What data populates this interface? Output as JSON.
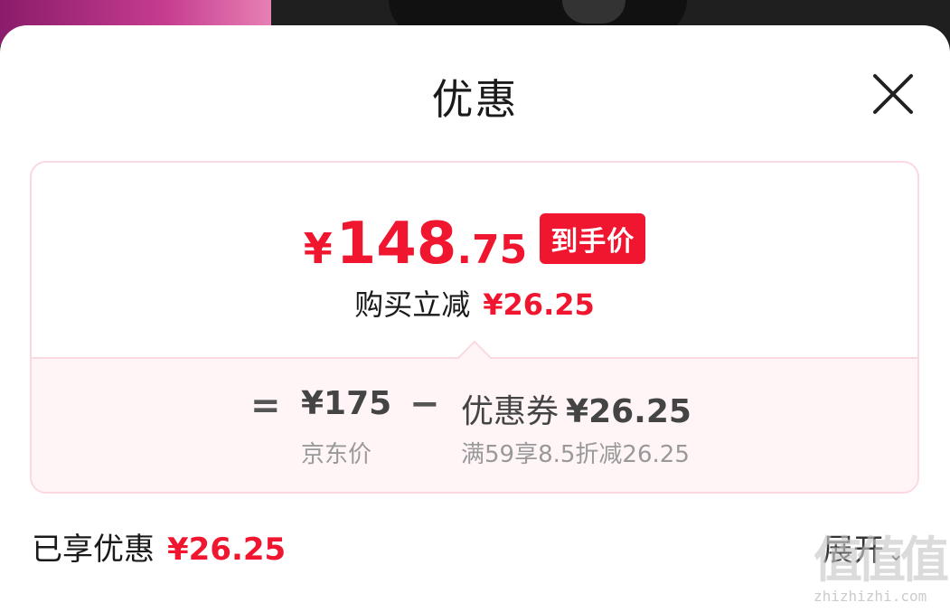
{
  "sheet": {
    "title": "优惠"
  },
  "price_card": {
    "final_price": {
      "yen": "¥",
      "integer": "148",
      "decimal": ".75"
    },
    "badge": "到手价",
    "saving_label": "购买立减",
    "saving_amount": "¥26.25",
    "formula": {
      "equals": "=",
      "jd_price": "¥175",
      "jd_price_label": "京东价",
      "minus": "−",
      "coupon_label": "优惠券",
      "coupon_amount": "¥26.25",
      "coupon_desc": "满59享8.5折减26.25"
    }
  },
  "footer": {
    "enjoyed_label": "已享优惠",
    "enjoyed_amount": "¥26.25",
    "expand_label": "展开"
  },
  "watermark": {
    "text": "值值值",
    "url": "zhizhizhi.com"
  },
  "colors": {
    "accent": "#f0162f",
    "card_border": "#fbd9e0",
    "card_lower_bg": "#fff5f7"
  },
  "icons": {
    "close": "close-icon",
    "expand": "chevron-down-icon"
  }
}
